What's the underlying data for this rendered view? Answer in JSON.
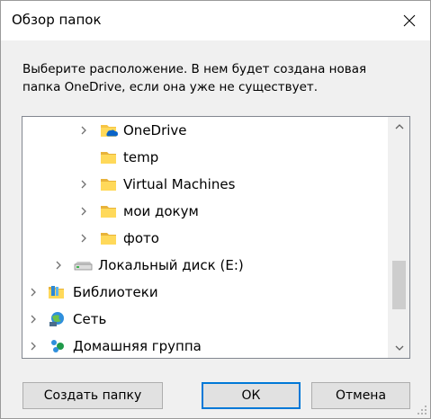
{
  "window": {
    "title": "Обзор папок",
    "close_icon": "close-icon"
  },
  "description": "Выберите расположение. В нем будет создана новая папка OneDrive, если она уже не существует.",
  "tree": {
    "items": [
      {
        "label": "OneDrive",
        "icon": "onedrive-folder-icon",
        "has_children": true
      },
      {
        "label": "temp",
        "icon": "folder-icon",
        "has_children": false
      },
      {
        "label": "Virtual Machines",
        "icon": "folder-icon",
        "has_children": true
      },
      {
        "label": "мои докум",
        "icon": "folder-icon",
        "has_children": true
      },
      {
        "label": "фото",
        "icon": "folder-icon",
        "has_children": true
      },
      {
        "label": "Локальный диск (E:)",
        "icon": "drive-icon",
        "has_children": true
      },
      {
        "label": "Библиотеки",
        "icon": "libraries-icon",
        "has_children": true
      },
      {
        "label": "Сеть",
        "icon": "network-icon",
        "has_children": true
      },
      {
        "label": "Домашняя группа",
        "icon": "homegroup-icon",
        "has_children": true
      }
    ]
  },
  "buttons": {
    "make_folder": "Создать папку",
    "ok": "ОК",
    "cancel": "Отмена"
  },
  "colors": {
    "folder": "#f6c443",
    "focus_border": "#0078d7",
    "onedrive": "#0a64c8"
  }
}
